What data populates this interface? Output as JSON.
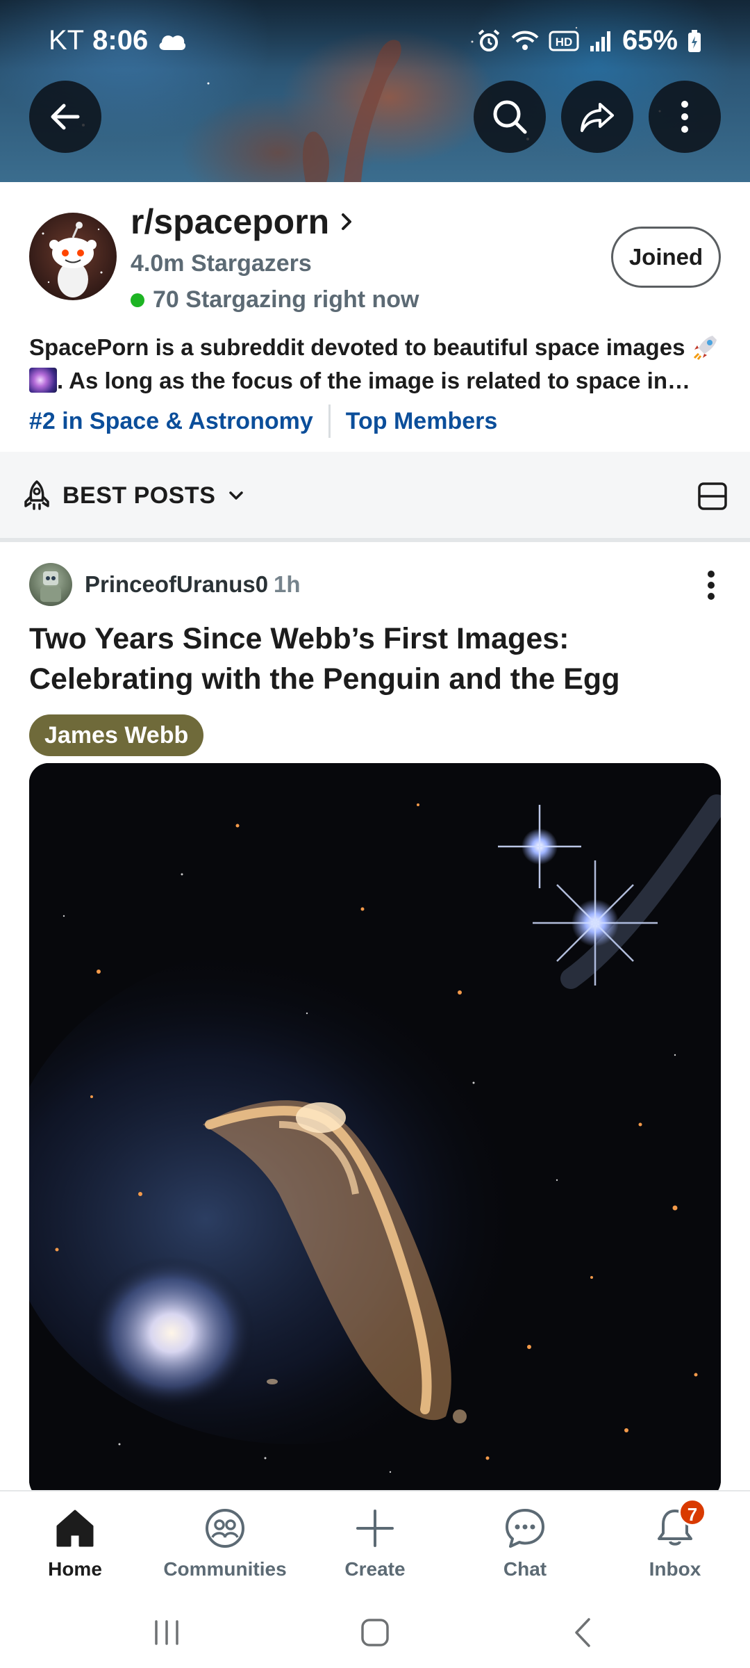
{
  "status_bar": {
    "carrier": "KT",
    "time": "8:06",
    "battery": "65%"
  },
  "community": {
    "name": "r/spaceporn",
    "members": "4.0m Stargazers",
    "online": "70 Stargazing right now",
    "join_state": "Joined",
    "description_part1": "SpacePorn is a subreddit devoted to beautiful space images ",
    "description_part2": ". As long as the focus of the image is related to space in some way, all pictures are welcome here.",
    "rank_link": "#2 in Space & Astronomy",
    "members_link": "Top Members"
  },
  "sort": {
    "label": "BEST POSTS"
  },
  "post": {
    "author": "PrinceofUranus0",
    "age": "1h",
    "title": "Two Years Since Webb’s First Images: Celebrating with the Penguin and the Egg",
    "flair": "James Webb"
  },
  "bottom_nav": {
    "items": [
      {
        "label": "Home",
        "icon": "home-icon"
      },
      {
        "label": "Communities",
        "icon": "communities-icon"
      },
      {
        "label": "Create",
        "icon": "plus-icon"
      },
      {
        "label": "Chat",
        "icon": "chat-icon"
      },
      {
        "label": "Inbox",
        "icon": "bell-icon"
      }
    ],
    "inbox_badge": "7"
  },
  "colors": {
    "link": "#0b4e9a",
    "online": "#1db423",
    "flair_bg": "#6f6a3a",
    "badge": "#d93a00"
  }
}
